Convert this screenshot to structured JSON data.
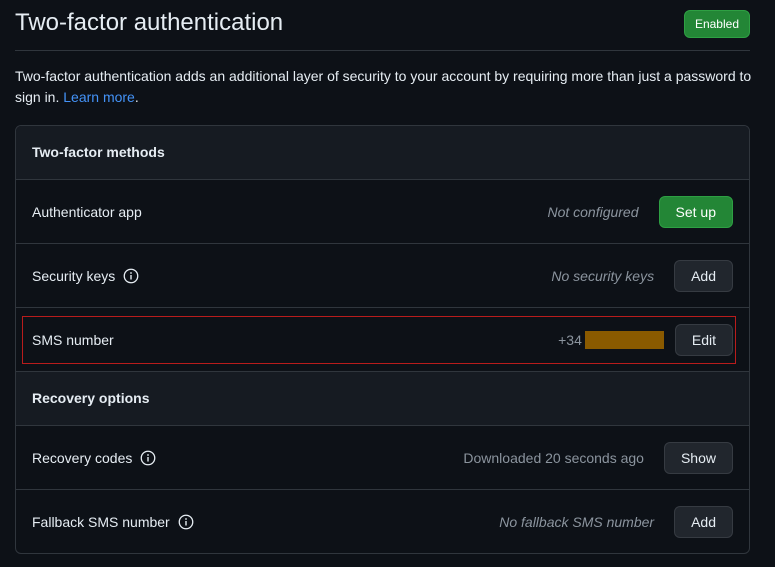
{
  "header": {
    "title": "Two-factor authentication",
    "status_badge": "Enabled"
  },
  "description": {
    "text": "Two-factor authentication adds an additional layer of security to your account by requiring more than just a password to sign in.",
    "link": "Learn more",
    "trailing": "."
  },
  "methods": {
    "title": "Two-factor methods",
    "authenticator": {
      "label": "Authenticator app",
      "status": "Not configured",
      "button": "Set up"
    },
    "security_keys": {
      "label": "Security keys",
      "status": "No security keys",
      "button": "Add"
    },
    "sms": {
      "label": "SMS number",
      "phone_prefix": "+34",
      "button": "Edit"
    }
  },
  "recovery": {
    "title": "Recovery options",
    "codes": {
      "label": "Recovery codes",
      "status": "Downloaded 20 seconds ago",
      "button": "Show"
    },
    "fallback_sms": {
      "label": "Fallback SMS number",
      "status": "No fallback SMS number",
      "button": "Add"
    }
  },
  "colors": {
    "background": "#0d1117",
    "panel_header": "#161b22",
    "border": "#30363d",
    "primary_green": "#238636",
    "link_blue": "#4493f8",
    "muted_text": "#8b949e",
    "highlight_red": "#b91c1c",
    "redaction": "#8a5a00"
  },
  "icons": {
    "info": "info-icon"
  }
}
